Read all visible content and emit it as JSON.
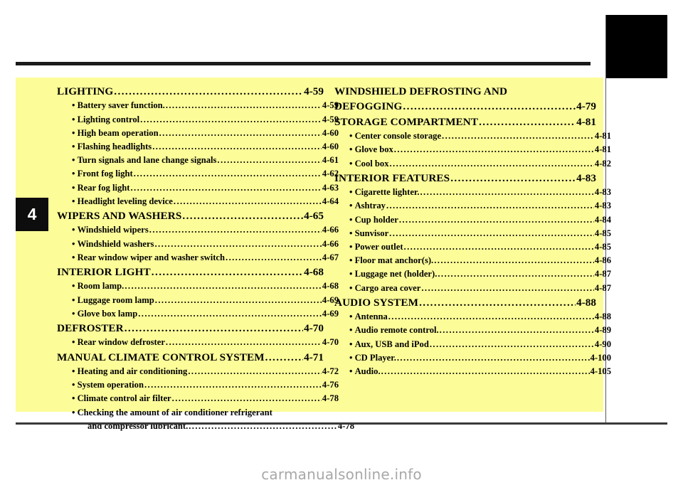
{
  "document": {
    "chapter_number": "4",
    "watermark": "carmanualsonline.info",
    "colors": {
      "panel_background": "#fcfc99",
      "page_background": "#ffffff",
      "rule": "#1a1a1a",
      "tab": "#0d0d0d",
      "text": "#000000",
      "watermark": "#a8a8a8"
    }
  },
  "toc": {
    "left_column": [
      {
        "type": "major",
        "label": "LIGHTING",
        "page": "4-59"
      },
      {
        "type": "minor",
        "label": "Battery saver function.",
        "page": "4-59"
      },
      {
        "type": "minor",
        "label": "Lighting control",
        "page": "4-59"
      },
      {
        "type": "minor",
        "label": "High beam operation",
        "page": "4-60"
      },
      {
        "type": "minor",
        "label": "Flashing headlights",
        "page": "4-60"
      },
      {
        "type": "minor",
        "label": "Turn signals and lane change signals",
        "page": "4-61"
      },
      {
        "type": "minor",
        "label": "Front fog light",
        "page": "4-62"
      },
      {
        "type": "minor",
        "label": "Rear fog light",
        "page": "4-63"
      },
      {
        "type": "minor",
        "label": "Headlight leveling device",
        "page": "4-64"
      },
      {
        "type": "major",
        "label": "WIPERS AND WASHERS",
        "page": "4-65"
      },
      {
        "type": "minor",
        "label": "Windshield wipers",
        "page": "4-66"
      },
      {
        "type": "minor",
        "label": "Windshield washers",
        "page": "4-66"
      },
      {
        "type": "minor",
        "label": "Rear window wiper and washer switch",
        "page": "4-67"
      },
      {
        "type": "major",
        "label": "INTERIOR LIGHT",
        "page": "4-68"
      },
      {
        "type": "minor",
        "label": "Room lamp.",
        "page": "4-68"
      },
      {
        "type": "minor",
        "label": "Luggage room lamp",
        "page": "4-69"
      },
      {
        "type": "minor",
        "label": "Glove box lamp",
        "page": "4-69"
      },
      {
        "type": "major",
        "label": "DEFROSTER",
        "page": "4-70"
      },
      {
        "type": "minor",
        "label": "Rear window defroster",
        "page": "4-70"
      },
      {
        "type": "major",
        "label": "MANUAL CLIMATE CONTROL SYSTEM",
        "page": "4-71"
      },
      {
        "type": "minor",
        "label": "Heating and air conditioning",
        "page": "4-72"
      },
      {
        "type": "minor",
        "label": "System operation",
        "page": "4-76"
      },
      {
        "type": "minor",
        "label": "Climate control air filter",
        "page": "4-78"
      },
      {
        "type": "minor-nodots",
        "label": "Checking the amount of air conditioner refrigerant",
        "page": ""
      },
      {
        "type": "cont",
        "label": "and compressor lubricant.",
        "page": "4-78"
      }
    ],
    "right_column": [
      {
        "type": "major-nodots",
        "label": "WINDSHIELD DEFROSTING AND",
        "page": ""
      },
      {
        "type": "major",
        "label": "DEFOGGING",
        "page": "4-79"
      },
      {
        "type": "major",
        "label": "STORAGE COMPARTMENT",
        "page": "4-81"
      },
      {
        "type": "minor",
        "label": "Center console storage",
        "page": "4-81"
      },
      {
        "type": "minor",
        "label": "Glove box",
        "page": "4-81"
      },
      {
        "type": "minor",
        "label": "Cool box",
        "page": "4-82"
      },
      {
        "type": "major",
        "label": "INTERIOR FEATURES",
        "page": "4-83"
      },
      {
        "type": "minor",
        "label": "Cigarette lighter.",
        "page": "4-83"
      },
      {
        "type": "minor",
        "label": "Ashtray",
        "page": "4-83"
      },
      {
        "type": "minor",
        "label": "Cup holder",
        "page": "4-84"
      },
      {
        "type": "minor",
        "label": "Sunvisor",
        "page": "4-85"
      },
      {
        "type": "minor",
        "label": "Power outlet",
        "page": "4-85"
      },
      {
        "type": "minor",
        "label": "Floor mat anchor(s).",
        "page": "4-86"
      },
      {
        "type": "minor",
        "label": "Luggage net (holder).",
        "page": "4-87"
      },
      {
        "type": "minor",
        "label": "Cargo area cover",
        "page": "4-87"
      },
      {
        "type": "major",
        "label": "AUDIO SYSTEM",
        "page": "4-88"
      },
      {
        "type": "minor",
        "label": "Antenna",
        "page": "4-88"
      },
      {
        "type": "minor",
        "label": "Audio remote control.",
        "page": "4-89"
      },
      {
        "type": "minor",
        "label": "Aux, USB and iPod",
        "page": "4-90"
      },
      {
        "type": "minor",
        "label": "CD Player.",
        "page": "4-100"
      },
      {
        "type": "minor",
        "label": "Audio.",
        "page": "4-105"
      }
    ]
  }
}
